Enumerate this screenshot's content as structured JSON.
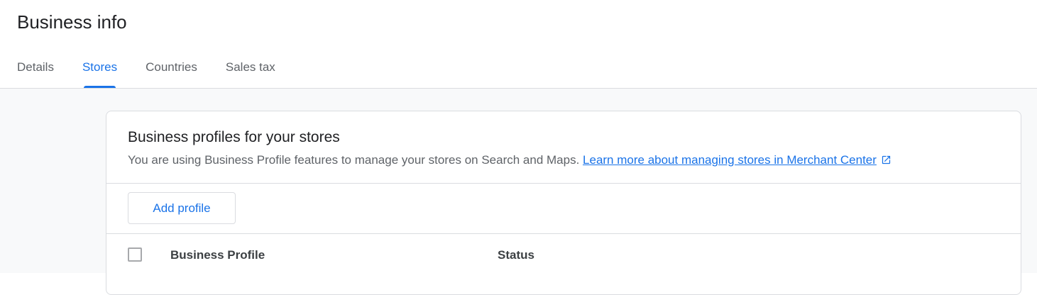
{
  "header": {
    "title": "Business info",
    "tabs": [
      {
        "label": "Details",
        "active": false
      },
      {
        "label": "Stores",
        "active": true
      },
      {
        "label": "Countries",
        "active": false
      },
      {
        "label": "Sales tax",
        "active": false
      }
    ]
  },
  "card": {
    "title": "Business profiles for your stores",
    "description": "You are using Business Profile features to manage your stores on Search and Maps.",
    "learn_more_link": "Learn more about managing stores in Merchant Center",
    "link_icon": "open-in-new-icon",
    "add_button": "Add profile",
    "table": {
      "columns": [
        "Business Profile",
        "Status"
      ]
    }
  },
  "colors": {
    "accent": "#1a73e8",
    "text_primary": "#202124",
    "text_secondary": "#5f6368",
    "border": "#dadce0",
    "background": "#f8f9fa"
  }
}
